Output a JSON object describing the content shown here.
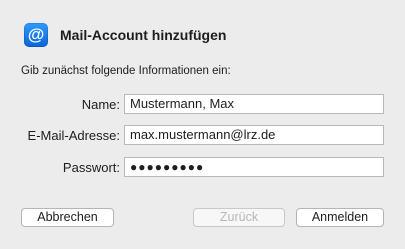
{
  "dialog": {
    "icon_name": "at-icon",
    "icon_glyph": "@",
    "title": "Mail-Account hinzufügen",
    "subtitle": "Gib zunächst folgende Informationen ein:"
  },
  "form": {
    "name_label": "Name:",
    "name_value": "Mustermann, Max",
    "email_label": "E-Mail-Adresse:",
    "email_value": "max.mustermann@lrz.de",
    "password_label": "Passwort:",
    "password_value": "●●●●●●●●●"
  },
  "buttons": {
    "cancel": "Abbrechen",
    "back": "Zurück",
    "signin": "Anmelden"
  },
  "colors": {
    "background": "#ececec",
    "icon_blue": "#1b7cf0"
  }
}
